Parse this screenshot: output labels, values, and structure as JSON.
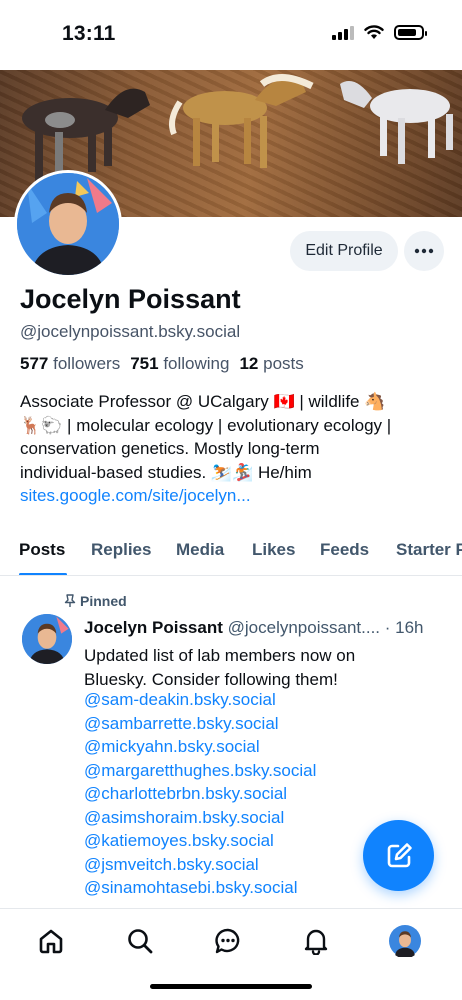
{
  "status_bar": {
    "time": "13:11"
  },
  "profile": {
    "name": "Jocelyn Poissant",
    "handle": "@jocelynpoissant.bsky.social",
    "followers_count": "577",
    "followers_label": "followers",
    "following_count": "751",
    "following_label": "following",
    "posts_count": "12",
    "posts_label": "posts",
    "edit_button_label": "Edit Profile",
    "bio_lines": [
      "Associate Professor @ UCalgary 🇨🇦 | wildlife 🐴",
      "🦌🐑 | molecular ecology | evolutionary ecology |",
      "conservation genetics. Mostly long-term",
      "individual-based studies. ⛷️🏂 He/him"
    ],
    "bio_link": "sites.google.com/site/jocelyn..."
  },
  "tabs": [
    "Posts",
    "Replies",
    "Media",
    "Likes",
    "Feeds",
    "Starter P"
  ],
  "pinned_post": {
    "pinned_label": "Pinned",
    "author": "Jocelyn Poissant",
    "handle": "@jocelynpoissant....",
    "time": "· 16h",
    "text_lines": [
      "Updated list of lab members now on",
      "Bluesky. Consider following them!"
    ],
    "mentions": [
      "@sam-deakin.bsky.social",
      "@sambarrette.bsky.social",
      "@mickyahn.bsky.social",
      "@margaretthughes.bsky.social",
      "@charlottebrbn.bsky.social",
      "@asimshoraim.bsky.social",
      "@katiemoyes.bsky.social",
      "@jsmveitch.bsky.social",
      "@sinamohtasebi.bsky.social"
    ]
  },
  "bottom_nav": [
    "home-icon",
    "search-icon",
    "chat-icon",
    "bell-icon",
    "profile-avatar"
  ],
  "colors": {
    "accent": "#1083fe",
    "muted": "#42576c",
    "button_bg": "#eef2f6"
  }
}
